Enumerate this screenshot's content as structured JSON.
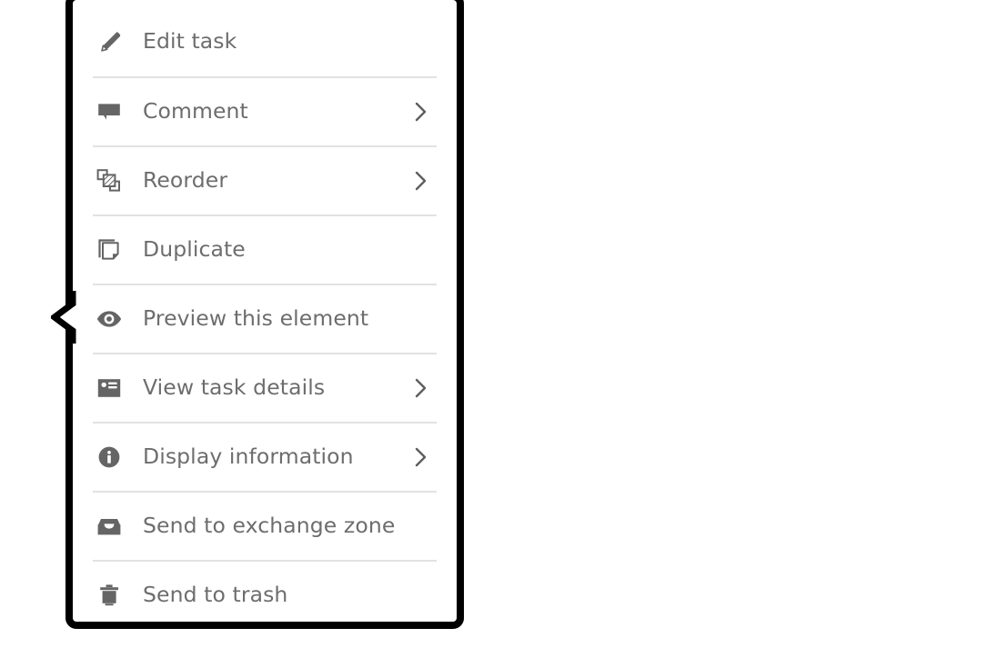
{
  "panel": {
    "name": "task-context-menu",
    "background_color": "#ffffff",
    "border_color": "#000000",
    "divider_color": "#e2e2e2",
    "text_color": "#6d6d6d",
    "icon_color": "#656565"
  },
  "menu": {
    "items": [
      {
        "label": "Edit task",
        "icon": "pencil-icon",
        "submenu": false
      },
      {
        "label": "Comment",
        "icon": "speech-bubble-icon",
        "submenu": true
      },
      {
        "label": "Reorder",
        "icon": "reorder-icon",
        "submenu": true
      },
      {
        "label": "Duplicate",
        "icon": "duplicate-icon",
        "submenu": false
      },
      {
        "label": "Preview this element",
        "icon": "eye-icon",
        "submenu": false
      },
      {
        "label": "View task details",
        "icon": "id-card-icon",
        "submenu": true
      },
      {
        "label": "Display information",
        "icon": "info-circle-icon",
        "submenu": true
      },
      {
        "label": "Send to exchange zone",
        "icon": "inbox-tray-icon",
        "submenu": false
      },
      {
        "label": "Send to trash",
        "icon": "trash-icon",
        "submenu": false
      }
    ]
  }
}
